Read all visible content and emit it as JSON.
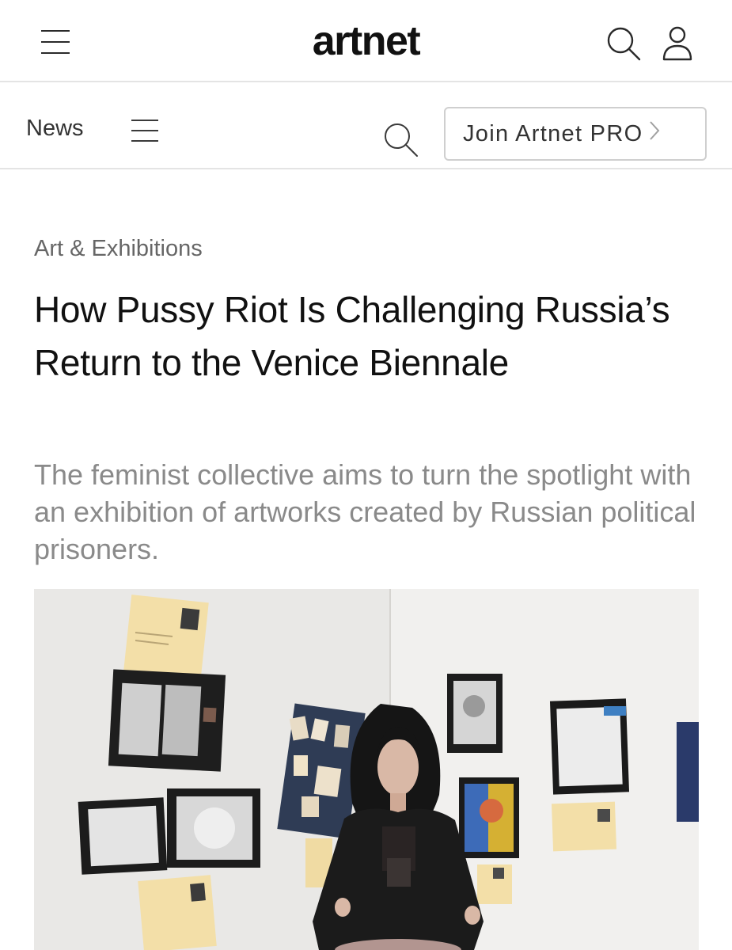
{
  "header": {
    "logo": "artnet",
    "menu_icon": "hamburger-menu-icon",
    "search_icon": "search-icon",
    "account_icon": "user-account-icon"
  },
  "subnav": {
    "section_label": "News",
    "menu_icon": "hamburger-menu-icon",
    "search_icon": "search-icon",
    "pro_button_label": "Join Artnet PRO",
    "pro_button_icon": "chevron-right-icon"
  },
  "article": {
    "category": "Art & Exhibitions",
    "headline": "How Pussy Riot Is Challenging Russia’s Return to the Venice Biennale",
    "dek": "The feminist collective aims to turn the spotlight with an exhibition of artworks created by Russian political prisoners."
  },
  "colors": {
    "text_primary": "#111111",
    "text_secondary": "#8a8a8a",
    "divider": "#e4e4e4",
    "button_border": "#cfcfcf"
  }
}
